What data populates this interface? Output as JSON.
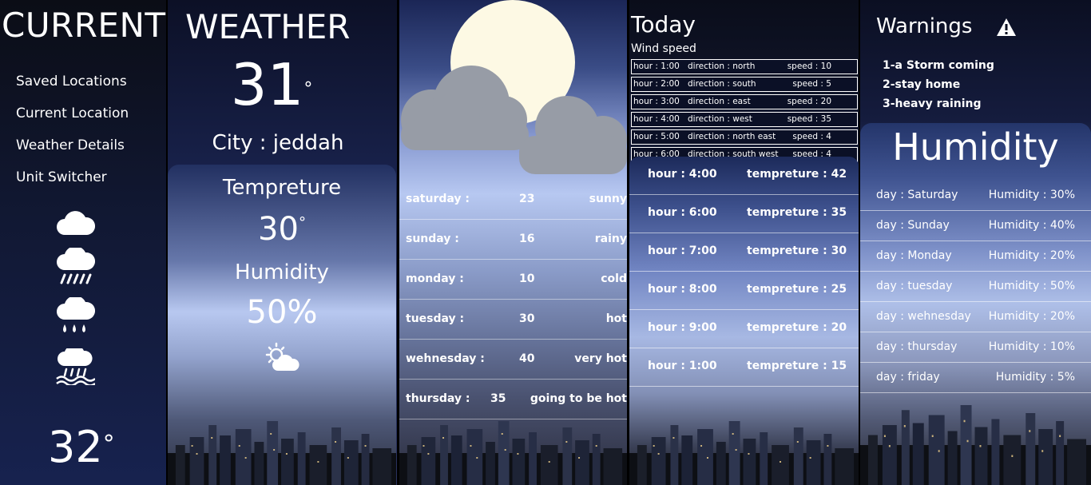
{
  "sidebar": {
    "title": "CURRENT",
    "nav": [
      "Saved Locations",
      "Current Location",
      "Weather Details",
      "Unit Switcher"
    ],
    "icons": [
      "cloud-icon",
      "rain-cloud-icon",
      "drizzle-cloud-icon",
      "flood-rain-icon"
    ],
    "temperature": "32",
    "degree_symbol": "°"
  },
  "current": {
    "title": "WEATHER",
    "temperature": "31",
    "city": "City : jeddah",
    "temp_label": "Tempreture",
    "temp_value": "30",
    "humidity_label": "Humidity",
    "humidity_value": "50%",
    "icon": "partly-sunny-icon"
  },
  "forecast": {
    "icon": "moon-cloud-icon",
    "rows": [
      {
        "day": "saturday :",
        "temp": "23",
        "cond": "sunny"
      },
      {
        "day": "sunday :",
        "temp": "16",
        "cond": "rainy"
      },
      {
        "day": "monday :",
        "temp": "10",
        "cond": "cold"
      },
      {
        "day": "tuesday :",
        "temp": "30",
        "cond": "hot"
      },
      {
        "day": "wehnesday :",
        "temp": "40",
        "cond": "very hot"
      },
      {
        "day": "thursday :",
        "temp": "35",
        "cond": "going to be hot"
      }
    ]
  },
  "today": {
    "title": "Today",
    "wind_title": "Wind speed",
    "wind": [
      {
        "hour": "hour : 1:00",
        "direction": "direction : north",
        "speed": "speed : 10"
      },
      {
        "hour": "hour : 2:00",
        "direction": "direction : south",
        "speed": "speed : 5"
      },
      {
        "hour": "hour : 3:00",
        "direction": "direction : east",
        "speed": "speed : 20"
      },
      {
        "hour": "hour : 4:00",
        "direction": "direction : west",
        "speed": "speed : 35"
      },
      {
        "hour": "hour : 5:00",
        "direction": "direction : north east",
        "speed": "speed : 4"
      },
      {
        "hour": "hour : 6:00",
        "direction": "direction : south west",
        "speed": "speed : 4"
      }
    ],
    "hourly": [
      {
        "hour": "hour : 4:00",
        "temp": "tempreture : 42"
      },
      {
        "hour": "hour : 6:00",
        "temp": "tempreture : 35"
      },
      {
        "hour": "hour : 7:00",
        "temp": "tempreture : 30"
      },
      {
        "hour": "hour : 8:00",
        "temp": "tempreture : 25"
      },
      {
        "hour": "hour : 9:00",
        "temp": "tempreture : 20"
      },
      {
        "hour": "hour : 1:00",
        "temp": "tempreture : 15"
      }
    ]
  },
  "warnings": {
    "title": "Warnings",
    "icon": "warning-icon",
    "items": [
      "1-a Storm coming",
      "2-stay home",
      "3-heavy raining"
    ],
    "humidity_title": "Humidity",
    "humidity": [
      {
        "day": "day : Saturday",
        "value": "Humidity : 30%"
      },
      {
        "day": "day : Sunday",
        "value": "Humidity : 40%"
      },
      {
        "day": "day : Monday",
        "value": "Humidity : 20%"
      },
      {
        "day": "day : tuesday",
        "value": "Humidity : 50%"
      },
      {
        "day": "day : wehnesday",
        "value": "Humidity : 20%"
      },
      {
        "day": "day : thursday",
        "value": "Humidity : 10%"
      },
      {
        "day": "day : friday",
        "value": "Humidity : 5%"
      }
    ]
  }
}
